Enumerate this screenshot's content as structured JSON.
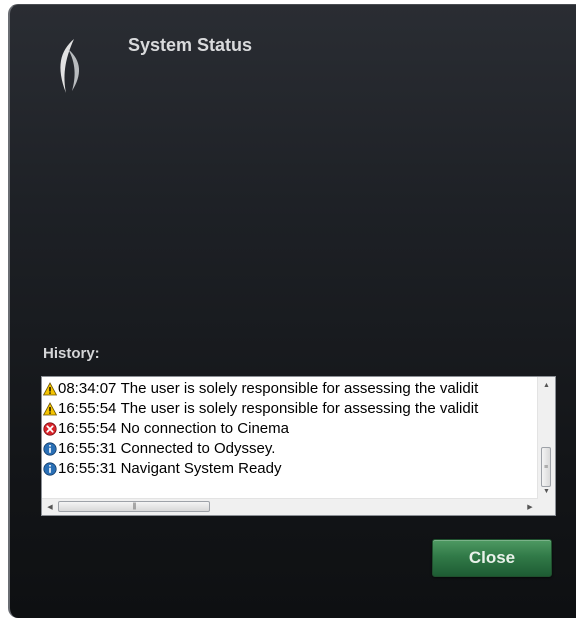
{
  "dialog": {
    "title": "System Status",
    "logo_icon": "navigant-logo-icon"
  },
  "history": {
    "label": "History:",
    "items": [
      {
        "icon": "warning-icon",
        "time": "08:34:07",
        "message": "The user is solely responsible for assessing the validit"
      },
      {
        "icon": "warning-icon",
        "time": "16:55:54",
        "message": "The user is solely responsible for assessing the validit"
      },
      {
        "icon": "error-icon",
        "time": "16:55:54",
        "message": "No connection to Cinema"
      },
      {
        "icon": "info-icon",
        "time": "16:55:31",
        "message": "Connected to Odyssey."
      },
      {
        "icon": "info-icon",
        "time": "16:55:31",
        "message": "Navigant System Ready"
      }
    ]
  },
  "buttons": {
    "close_label": "Close"
  },
  "colors": {
    "close_button": "#317a48",
    "warning": "#f5c400",
    "error": "#d9232a",
    "info": "#2a6fb5"
  }
}
